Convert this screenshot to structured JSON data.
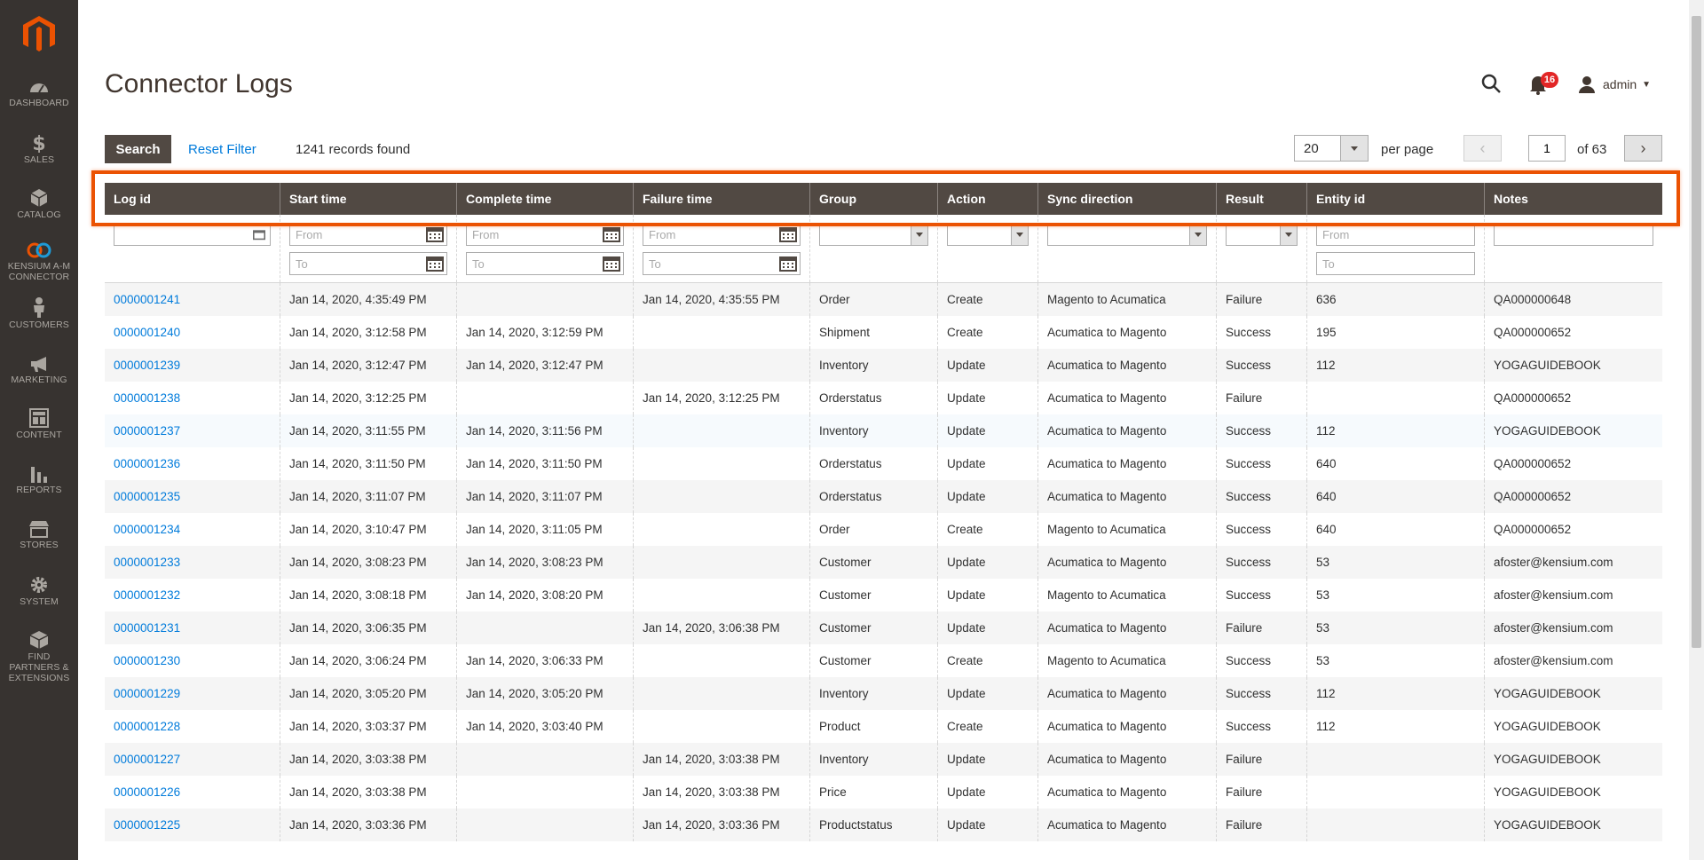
{
  "nav": [
    {
      "label": "DASHBOARD",
      "icon": "dashboard-icon"
    },
    {
      "label": "SALES",
      "icon": "dollar-icon"
    },
    {
      "label": "CATALOG",
      "icon": "cube-icon"
    },
    {
      "label": "KENSIUM A-M CONNECTOR",
      "icon": "connector-icon"
    },
    {
      "label": "CUSTOMERS",
      "icon": "person-icon"
    },
    {
      "label": "MARKETING",
      "icon": "megaphone-icon"
    },
    {
      "label": "CONTENT",
      "icon": "layout-icon"
    },
    {
      "label": "REPORTS",
      "icon": "bar-chart-icon"
    },
    {
      "label": "STORES",
      "icon": "storefront-icon"
    },
    {
      "label": "SYSTEM",
      "icon": "gear-icon"
    },
    {
      "label": "FIND PARTNERS & EXTENSIONS",
      "icon": "boxes-icon"
    }
  ],
  "header": {
    "title": "Connector Logs",
    "notification_count": "16",
    "user": "admin"
  },
  "toolbar": {
    "search_label": "Search",
    "reset_label": "Reset Filter",
    "records": "1241 records found",
    "per_page_value": "20",
    "per_page_label": "per page",
    "page": "1",
    "of_pages": "of 63"
  },
  "filter_placeholders": {
    "from": "From",
    "to": "To"
  },
  "columns": [
    "Log id",
    "Start time",
    "Complete time",
    "Failure time",
    "Group",
    "Action",
    "Sync direction",
    "Result",
    "Entity id",
    "Notes"
  ],
  "rows": [
    [
      "0000001241",
      "Jan 14, 2020, 4:35:49 PM",
      "",
      "Jan 14, 2020, 4:35:55 PM",
      "Order",
      "Create",
      "Magento to Acumatica",
      "Failure",
      "636",
      "QA000000648"
    ],
    [
      "0000001240",
      "Jan 14, 2020, 3:12:58 PM",
      "Jan 14, 2020, 3:12:59 PM",
      "",
      "Shipment",
      "Create",
      "Acumatica to Magento",
      "Success",
      "195",
      "QA000000652"
    ],
    [
      "0000001239",
      "Jan 14, 2020, 3:12:47 PM",
      "Jan 14, 2020, 3:12:47 PM",
      "",
      "Inventory",
      "Update",
      "Acumatica to Magento",
      "Success",
      "112",
      "YOGAGUIDEBOOK"
    ],
    [
      "0000001238",
      "Jan 14, 2020, 3:12:25 PM",
      "",
      "Jan 14, 2020, 3:12:25 PM",
      "Orderstatus",
      "Update",
      "Acumatica to Magento",
      "Failure",
      "",
      "QA000000652"
    ],
    [
      "0000001237",
      "Jan 14, 2020, 3:11:55 PM",
      "Jan 14, 2020, 3:11:56 PM",
      "",
      "Inventory",
      "Update",
      "Acumatica to Magento",
      "Success",
      "112",
      "YOGAGUIDEBOOK"
    ],
    [
      "0000001236",
      "Jan 14, 2020, 3:11:50 PM",
      "Jan 14, 2020, 3:11:50 PM",
      "",
      "Orderstatus",
      "Update",
      "Acumatica to Magento",
      "Success",
      "640",
      "QA000000652"
    ],
    [
      "0000001235",
      "Jan 14, 2020, 3:11:07 PM",
      "Jan 14, 2020, 3:11:07 PM",
      "",
      "Orderstatus",
      "Update",
      "Acumatica to Magento",
      "Success",
      "640",
      "QA000000652"
    ],
    [
      "0000001234",
      "Jan 14, 2020, 3:10:47 PM",
      "Jan 14, 2020, 3:11:05 PM",
      "",
      "Order",
      "Create",
      "Magento to Acumatica",
      "Success",
      "640",
      "QA000000652"
    ],
    [
      "0000001233",
      "Jan 14, 2020, 3:08:23 PM",
      "Jan 14, 2020, 3:08:23 PM",
      "",
      "Customer",
      "Update",
      "Acumatica to Magento",
      "Success",
      "53",
      "afoster@kensium.com"
    ],
    [
      "0000001232",
      "Jan 14, 2020, 3:08:18 PM",
      "Jan 14, 2020, 3:08:20 PM",
      "",
      "Customer",
      "Update",
      "Magento to Acumatica",
      "Success",
      "53",
      "afoster@kensium.com"
    ],
    [
      "0000001231",
      "Jan 14, 2020, 3:06:35 PM",
      "",
      "Jan 14, 2020, 3:06:38 PM",
      "Customer",
      "Update",
      "Acumatica to Magento",
      "Failure",
      "53",
      "afoster@kensium.com"
    ],
    [
      "0000001230",
      "Jan 14, 2020, 3:06:24 PM",
      "Jan 14, 2020, 3:06:33 PM",
      "",
      "Customer",
      "Create",
      "Magento to Acumatica",
      "Success",
      "53",
      "afoster@kensium.com"
    ],
    [
      "0000001229",
      "Jan 14, 2020, 3:05:20 PM",
      "Jan 14, 2020, 3:05:20 PM",
      "",
      "Inventory",
      "Update",
      "Acumatica to Magento",
      "Success",
      "112",
      "YOGAGUIDEBOOK"
    ],
    [
      "0000001228",
      "Jan 14, 2020, 3:03:37 PM",
      "Jan 14, 2020, 3:03:40 PM",
      "",
      "Product",
      "Create",
      "Acumatica to Magento",
      "Success",
      "112",
      "YOGAGUIDEBOOK"
    ],
    [
      "0000001227",
      "Jan 14, 2020, 3:03:38 PM",
      "",
      "Jan 14, 2020, 3:03:38 PM",
      "Inventory",
      "Update",
      "Acumatica to Magento",
      "Failure",
      "",
      "YOGAGUIDEBOOK"
    ],
    [
      "0000001226",
      "Jan 14, 2020, 3:03:38 PM",
      "",
      "Jan 14, 2020, 3:03:38 PM",
      "Price",
      "Update",
      "Acumatica to Magento",
      "Failure",
      "",
      "YOGAGUIDEBOOK"
    ],
    [
      "0000001225",
      "Jan 14, 2020, 3:03:36 PM",
      "",
      "Jan 14, 2020, 3:03:36 PM",
      "Productstatus",
      "Update",
      "Acumatica to Magento",
      "Failure",
      "",
      "YOGAGUIDEBOOK"
    ]
  ],
  "colors": {
    "accent": "#eb5202",
    "sidebar": "#373330",
    "header_bg": "#514943",
    "link": "#007bdb",
    "badge": "#e22626"
  }
}
